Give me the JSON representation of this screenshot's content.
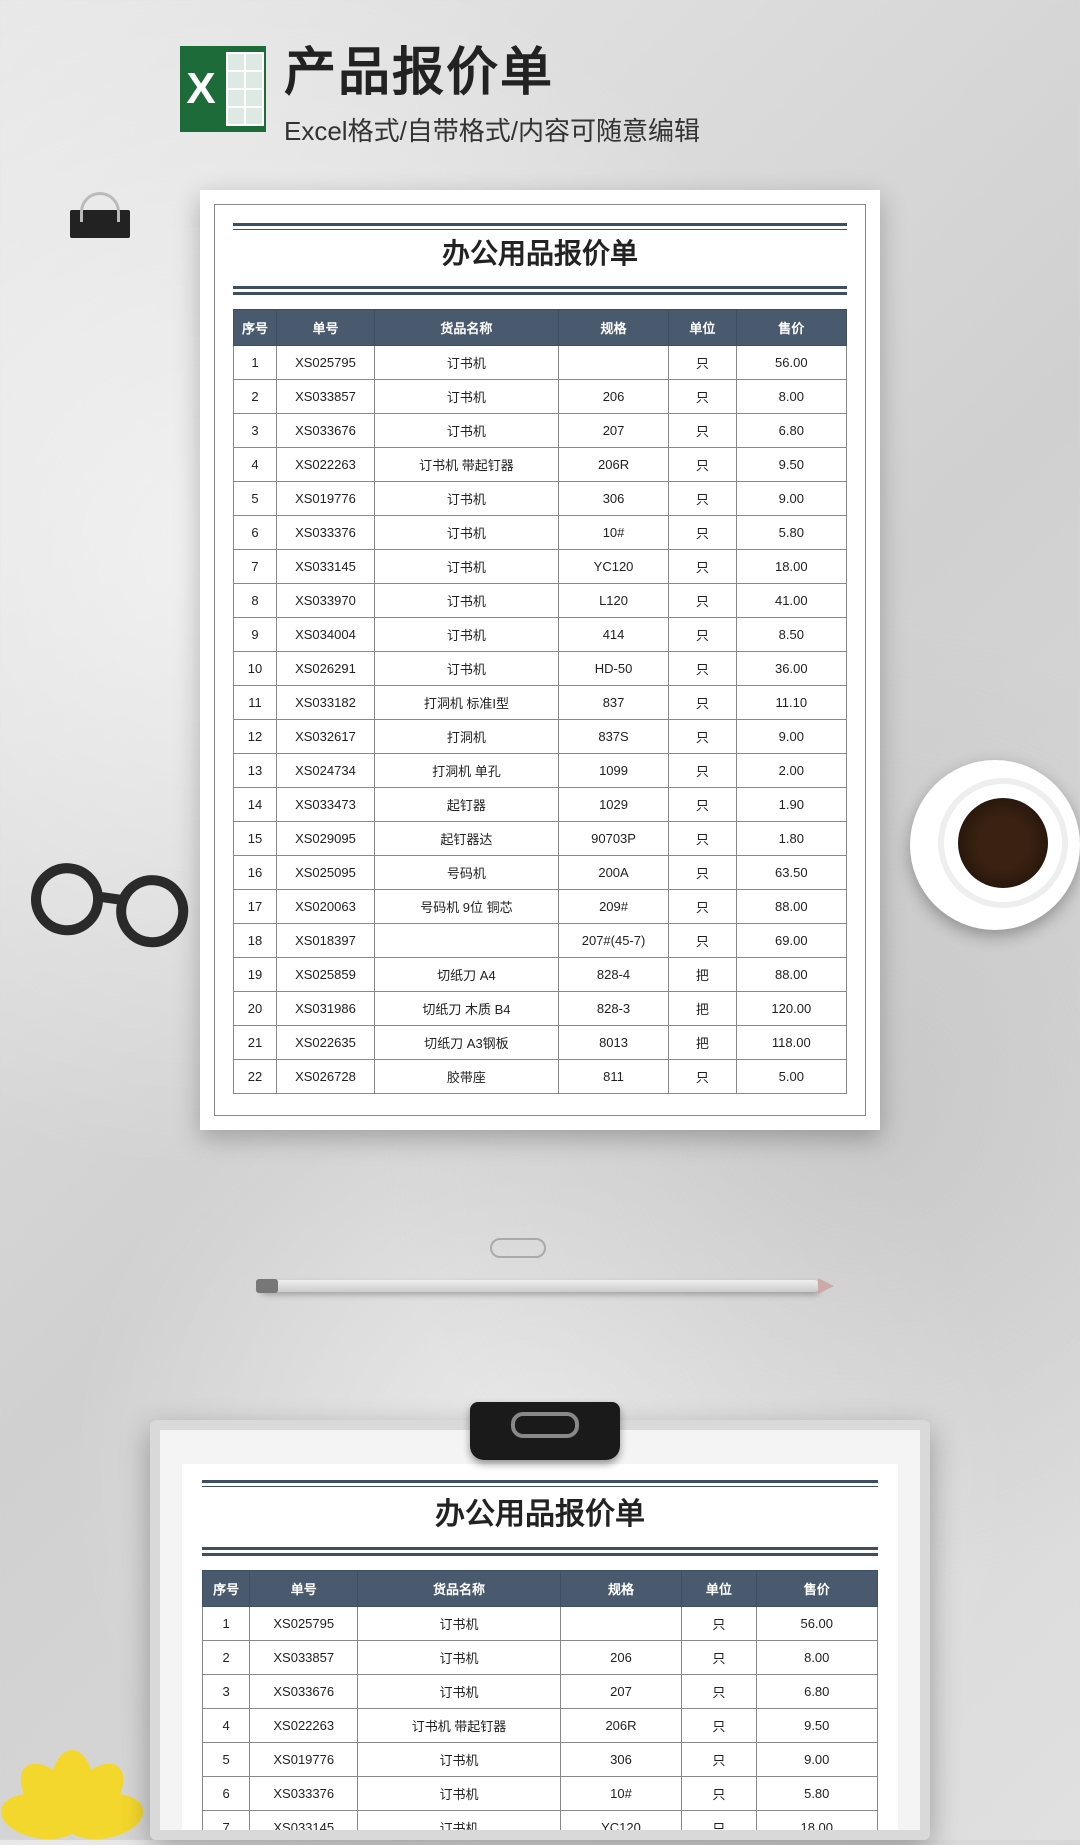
{
  "banner": {
    "title": "产品报价单",
    "subtitle": "Excel格式/自带格式/内容可随意编辑",
    "icon_letter": "X"
  },
  "document": {
    "title": "办公用品报价单",
    "columns": {
      "idx": "序号",
      "code": "单号",
      "name": "货品名称",
      "spec": "规格",
      "unit": "单位",
      "price": "售价"
    },
    "rows": [
      {
        "idx": "1",
        "code": "XS025795",
        "name": "订书机",
        "spec": "",
        "unit": "只",
        "price": "56.00"
      },
      {
        "idx": "2",
        "code": "XS033857",
        "name": "订书机",
        "spec": "206",
        "unit": "只",
        "price": "8.00"
      },
      {
        "idx": "3",
        "code": "XS033676",
        "name": "订书机",
        "spec": "207",
        "unit": "只",
        "price": "6.80"
      },
      {
        "idx": "4",
        "code": "XS022263",
        "name": "订书机 带起钉器",
        "spec": "206R",
        "unit": "只",
        "price": "9.50"
      },
      {
        "idx": "5",
        "code": "XS019776",
        "name": "订书机",
        "spec": "306",
        "unit": "只",
        "price": "9.00"
      },
      {
        "idx": "6",
        "code": "XS033376",
        "name": "订书机",
        "spec": "10#",
        "unit": "只",
        "price": "5.80"
      },
      {
        "idx": "7",
        "code": "XS033145",
        "name": "订书机",
        "spec": "YC120",
        "unit": "只",
        "price": "18.00"
      },
      {
        "idx": "8",
        "code": "XS033970",
        "name": "订书机",
        "spec": "L120",
        "unit": "只",
        "price": "41.00"
      },
      {
        "idx": "9",
        "code": "XS034004",
        "name": "订书机",
        "spec": "414",
        "unit": "只",
        "price": "8.50"
      },
      {
        "idx": "10",
        "code": "XS026291",
        "name": "订书机",
        "spec": "HD-50",
        "unit": "只",
        "price": "36.00"
      },
      {
        "idx": "11",
        "code": "XS033182",
        "name": "打洞机 标准I型",
        "spec": "837",
        "unit": "只",
        "price": "11.10"
      },
      {
        "idx": "12",
        "code": "XS032617",
        "name": "打洞机",
        "spec": "837S",
        "unit": "只",
        "price": "9.00"
      },
      {
        "idx": "13",
        "code": "XS024734",
        "name": "打洞机 单孔",
        "spec": "1099",
        "unit": "只",
        "price": "2.00"
      },
      {
        "idx": "14",
        "code": "XS033473",
        "name": "起钉器",
        "spec": "1029",
        "unit": "只",
        "price": "1.90"
      },
      {
        "idx": "15",
        "code": "XS029095",
        "name": "起钉器达",
        "spec": "90703P",
        "unit": "只",
        "price": "1.80"
      },
      {
        "idx": "16",
        "code": "XS025095",
        "name": "号码机",
        "spec": "200A",
        "unit": "只",
        "price": "63.50"
      },
      {
        "idx": "17",
        "code": "XS020063",
        "name": "号码机 9位 铜芯",
        "spec": "209#",
        "unit": "只",
        "price": "88.00"
      },
      {
        "idx": "18",
        "code": "XS018397",
        "name": "",
        "spec": "207#(45-7)",
        "unit": "只",
        "price": "69.00"
      },
      {
        "idx": "19",
        "code": "XS025859",
        "name": "切纸刀 A4",
        "spec": "828-4",
        "unit": "把",
        "price": "88.00"
      },
      {
        "idx": "20",
        "code": "XS031986",
        "name": "切纸刀 木质 B4",
        "spec": "828-3",
        "unit": "把",
        "price": "120.00"
      },
      {
        "idx": "21",
        "code": "XS022635",
        "name": "切纸刀 A3钢板",
        "spec": "8013",
        "unit": "把",
        "price": "118.00"
      },
      {
        "idx": "22",
        "code": "XS026728",
        "name": "胶带座",
        "spec": "811",
        "unit": "只",
        "price": "5.00"
      }
    ],
    "preview_rows": 7
  },
  "chart_data": {
    "type": "table",
    "title": "办公用品报价单",
    "columns": [
      "序号",
      "单号",
      "货品名称",
      "规格",
      "单位",
      "售价"
    ],
    "rows": [
      [
        "1",
        "XS025795",
        "订书机",
        "",
        "只",
        56.0
      ],
      [
        "2",
        "XS033857",
        "订书机",
        "206",
        "只",
        8.0
      ],
      [
        "3",
        "XS033676",
        "订书机",
        "207",
        "只",
        6.8
      ],
      [
        "4",
        "XS022263",
        "订书机 带起钉器",
        "206R",
        "只",
        9.5
      ],
      [
        "5",
        "XS019776",
        "订书机",
        "306",
        "只",
        9.0
      ],
      [
        "6",
        "XS033376",
        "订书机",
        "10#",
        "只",
        5.8
      ],
      [
        "7",
        "XS033145",
        "订书机",
        "YC120",
        "只",
        18.0
      ],
      [
        "8",
        "XS033970",
        "订书机",
        "L120",
        "只",
        41.0
      ],
      [
        "9",
        "XS034004",
        "订书机",
        "414",
        "只",
        8.5
      ],
      [
        "10",
        "XS026291",
        "订书机",
        "HD-50",
        "只",
        36.0
      ],
      [
        "11",
        "XS033182",
        "打洞机 标准I型",
        "837",
        "只",
        11.1
      ],
      [
        "12",
        "XS032617",
        "打洞机",
        "837S",
        "只",
        9.0
      ],
      [
        "13",
        "XS024734",
        "打洞机 单孔",
        "1099",
        "只",
        2.0
      ],
      [
        "14",
        "XS033473",
        "起钉器",
        "1029",
        "只",
        1.9
      ],
      [
        "15",
        "XS029095",
        "起钉器达",
        "90703P",
        "只",
        1.8
      ],
      [
        "16",
        "XS025095",
        "号码机",
        "200A",
        "只",
        63.5
      ],
      [
        "17",
        "XS020063",
        "号码机 9位 铜芯",
        "209#",
        "只",
        88.0
      ],
      [
        "18",
        "XS018397",
        "",
        "207#(45-7)",
        "只",
        69.0
      ],
      [
        "19",
        "XS025859",
        "切纸刀 A4",
        "828-4",
        "把",
        88.0
      ],
      [
        "20",
        "XS031986",
        "切纸刀 木质 B4",
        "828-3",
        "把",
        120.0
      ],
      [
        "21",
        "XS022635",
        "切纸刀 A3钢板",
        "8013",
        "把",
        118.0
      ],
      [
        "22",
        "XS026728",
        "胶带座",
        "811",
        "只",
        5.0
      ]
    ]
  }
}
